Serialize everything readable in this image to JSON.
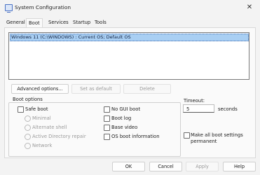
{
  "window": {
    "title": "System Configuration",
    "close_glyph": "✕"
  },
  "tabs": [
    "General",
    "Boot",
    "Services",
    "Startup",
    "Tools"
  ],
  "os_list": {
    "selected_entry": "Windows 11 (C:\\WINDOWS) : Current OS; Default OS"
  },
  "list_buttons": {
    "advanced": "Advanced options...",
    "set_default": "Set as default",
    "delete": "Delete"
  },
  "boot_options": {
    "label": "Boot options",
    "safe_boot": "Safe boot",
    "radios": [
      "Minimal",
      "Alternate shell",
      "Active Directory repair",
      "Network"
    ],
    "no_gui_boot": "No GUI boot",
    "boot_log": "Boot log",
    "base_video": "Base video",
    "os_boot_information": "OS boot information"
  },
  "timeout": {
    "label": "Timeout:",
    "value": "5",
    "unit": "seconds"
  },
  "make_permanent": {
    "line1": "Make all boot settings",
    "line2": "permanent"
  },
  "footer": {
    "ok": "OK",
    "cancel": "Cancel",
    "apply": "Apply",
    "help": "Help"
  }
}
